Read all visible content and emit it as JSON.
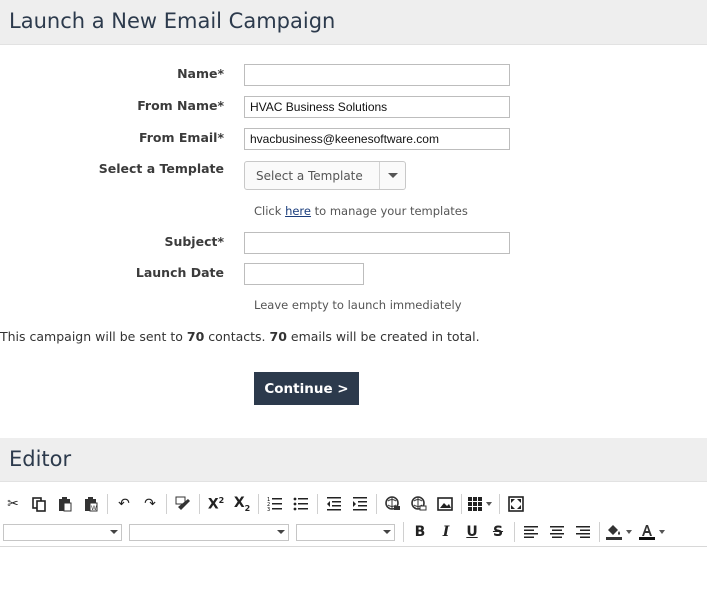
{
  "campaign": {
    "title": "Launch a New Email Campaign",
    "name_label": "Name*",
    "name_value": "",
    "from_name_label": "From Name*",
    "from_name_value": "HVAC Business Solutions",
    "from_email_label": "From Email*",
    "from_email_value": "hvacbusiness@keenesoftware.com",
    "template_label": "Select a Template",
    "template_selected": "Select a Template",
    "template_help_prefix": "Click",
    "template_help_link": "here",
    "template_help_suffix": "to manage your templates",
    "subject_label": "Subject*",
    "subject_value": "",
    "launch_date_label": "Launch Date",
    "launch_date_value": "",
    "launch_help": "Leave empty to launch immediately",
    "summary_part1": "This campaign will be sent to",
    "contacts_count": "70",
    "summary_part2": "contacts.",
    "emails_count": "70",
    "summary_part3": "emails will be created in total.",
    "continue_label": "Continue >"
  },
  "editor": {
    "title": "Editor",
    "toolbar_icons": [
      "cut-icon",
      "copy-icon",
      "paste-icon",
      "paste-word-icon",
      "undo-icon",
      "redo-icon",
      "spellcheck-icon",
      "superscript-icon",
      "subscript-icon",
      "numbered-list-icon",
      "bulleted-list-icon",
      "outdent-icon",
      "indent-icon",
      "link-icon",
      "unlink-icon",
      "image-icon",
      "table-icon",
      "fullscreen-icon"
    ],
    "format_buttons": {
      "bold": "B",
      "italic": "I",
      "underline": "U",
      "strike": "S"
    }
  }
}
